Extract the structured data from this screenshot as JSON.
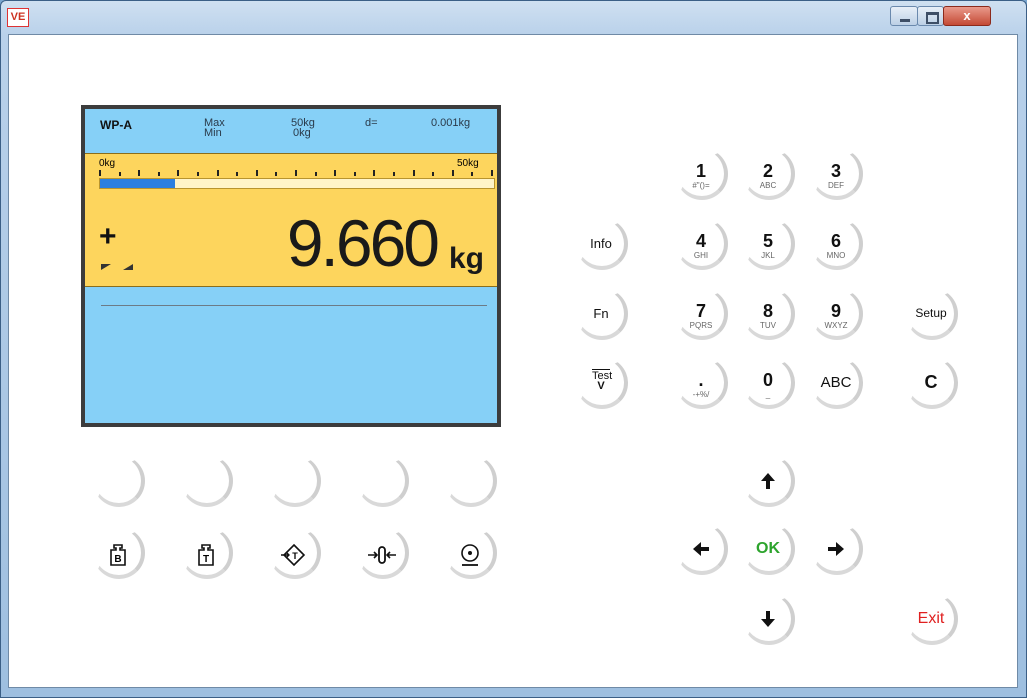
{
  "window": {
    "icon_text": "VE",
    "close_symbol": "x"
  },
  "display": {
    "model": "WP-A",
    "max_label": "Max",
    "min_label": "Min",
    "max_value": "50kg",
    "min_value": "0kg",
    "d_label": "d=",
    "d_value": "0.001kg",
    "scale_min": "0kg",
    "scale_max": "50kg",
    "bar_fraction": 0.19,
    "sign": "+",
    "weight": "9.660",
    "unit": "kg"
  },
  "keys": {
    "info": "Info",
    "fn": "Fn",
    "test_main": "Test",
    "test_arrow": "V",
    "setup": "Setup",
    "c": "C",
    "abc": "ABC",
    "ok": "OK",
    "exit": "Exit",
    "digits": [
      {
        "main": "1",
        "sub": "#\"()="
      },
      {
        "main": "2",
        "sub": "ABC"
      },
      {
        "main": "3",
        "sub": "DEF"
      },
      {
        "main": "4",
        "sub": "GHI"
      },
      {
        "main": "5",
        "sub": "JKL"
      },
      {
        "main": "6",
        "sub": "MNO"
      },
      {
        "main": "7",
        "sub": "PQRS"
      },
      {
        "main": "8",
        "sub": "TUV"
      },
      {
        "main": "9",
        "sub": "WXYZ"
      },
      {
        "main": ".",
        "sub": "-+%/"
      },
      {
        "main": "0",
        "sub": "_"
      }
    ],
    "func_icons": {
      "b": "B",
      "t": "T"
    }
  }
}
